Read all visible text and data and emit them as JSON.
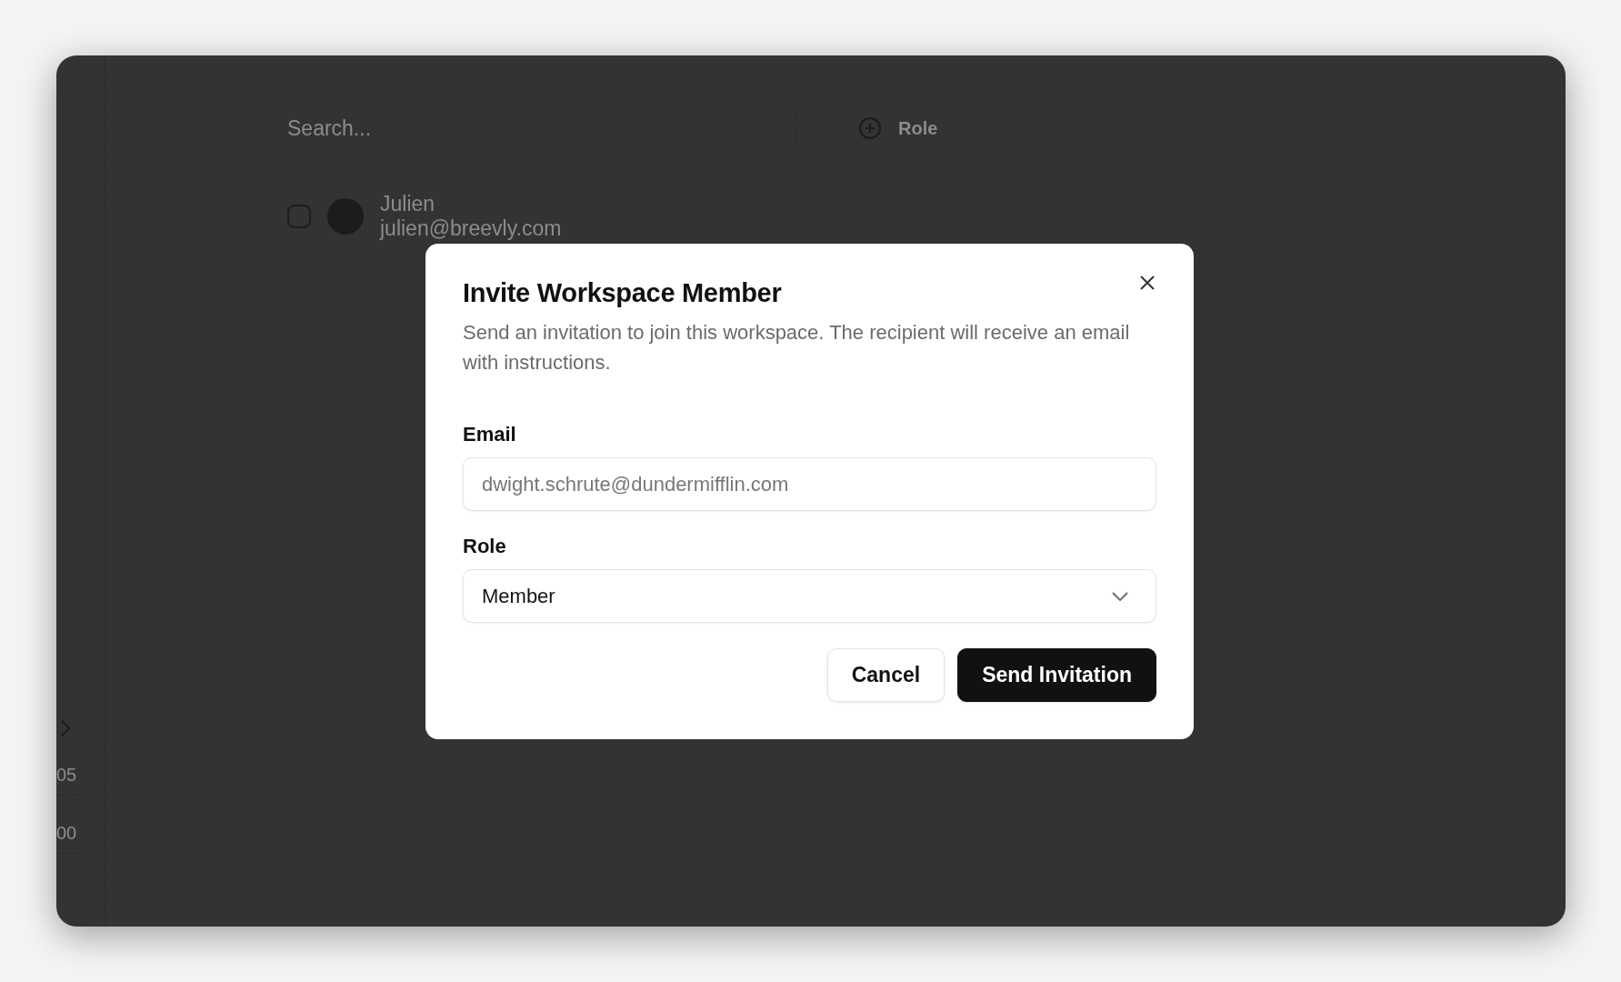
{
  "background": {
    "search": {
      "placeholder": "Search..."
    },
    "filter": {
      "label": "Role"
    },
    "members": [
      {
        "name": "Julien",
        "email": "julien@breevly.com",
        "checked": false
      }
    ],
    "sidebar": {
      "values": [
        "05",
        "00"
      ]
    }
  },
  "dialog": {
    "title": "Invite Workspace Member",
    "description": "Send an invitation to join this workspace. The recipient will receive an email with instructions.",
    "fields": [
      {
        "kind": "input",
        "label": "Email",
        "placeholder": "dwight.schrute@dundermifflin.com"
      },
      {
        "kind": "select",
        "label": "Role",
        "value": "Member"
      }
    ],
    "buttons": [
      {
        "kind": "secondary",
        "label": "Cancel"
      },
      {
        "kind": "primary",
        "label": "Send Invitation"
      }
    ]
  }
}
